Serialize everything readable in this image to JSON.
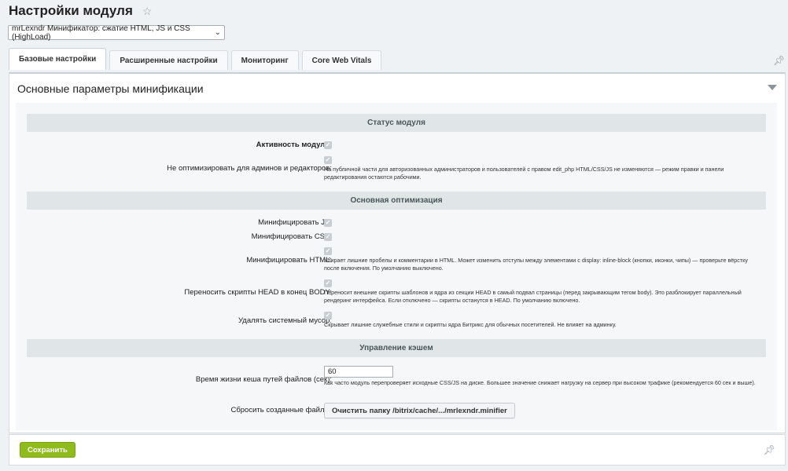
{
  "header": {
    "title": "Настройки модуля"
  },
  "module_select": {
    "value": "mrLexndr Минификатор: сжатие HTML, JS и CSS (HighLoad)"
  },
  "tabs": [
    {
      "label": "Базовые настройки"
    },
    {
      "label": "Расширенные настройки"
    },
    {
      "label": "Мониторинг"
    },
    {
      "label": "Core Web Vitals"
    }
  ],
  "panel": {
    "title": "Основные параметры минификации"
  },
  "sections": {
    "status": "Статус модуля",
    "optimization": "Основная оптимизация",
    "cache": "Управление кэшем"
  },
  "fields": {
    "active": {
      "label": "Активность модуля:",
      "checked": true
    },
    "no_admin": {
      "label": "Не оптимизировать для админов и редакторов:",
      "checked": true,
      "hint": "На публичной части для авторизованных администраторов и пользователей с правом edit_php HTML/CSS/JS не изменяются — режим правки и панели редактирования остаются рабочими."
    },
    "minify_js": {
      "label": "Минифицировать JS:",
      "checked": true
    },
    "minify_css": {
      "label": "Минифицировать CSS:",
      "checked": true
    },
    "minify_html": {
      "label": "Минифицировать HTML:",
      "checked": true,
      "hint": "Убирает лишние пробелы и комментарии в HTML. Может изменить отступы между элементами с display: inline-block (кнопки, иконки, чипы) — проверьте вёрстку после включения. По умолчанию выключено."
    },
    "move_scripts": {
      "label": "Переносить скрипты HEAD в конец BODY:",
      "checked": true,
      "hint": "Переносит внешние скрипты шаблонов и ядра из секции HEAD в самый подвал страницы (перед закрывающим тегом body). Это разблокирует параллельный рендеринг интерфейса. Если отключено — скрипты останутся в HEAD. По умолчанию включено."
    },
    "remove_junk": {
      "label": "Удалять системный мусор:",
      "checked": true,
      "hint": "Скрывает лишние служебные стили и скрипты ядра Битрикс для обычных посетителей. Не влияет на админку."
    },
    "cache_ttl": {
      "label": "Время жизни кеша путей файлов (сек):",
      "value": "60",
      "hint": "Как часто модуль перепроверяет исходные CSS/JS на диске. Большее значение снижает нагрузку на сервер при высоком трафике (рекомендуется 60 сек и выше)."
    },
    "reset_files": {
      "label": "Сбросить созданные файлы:",
      "button": "Очистить папку /bitrix/cache/.../mrlexndr.minifier"
    }
  },
  "footer": {
    "save_label": "Сохранить"
  },
  "icons": {
    "star": "star-icon",
    "pin": "pin-icon",
    "collapse": "chevron-down-icon",
    "check": "checkmark-icon"
  },
  "colors": {
    "save_button": "#8fbb1c",
    "section_header": "#e0e6e8",
    "checkbox": "#c8ced2"
  }
}
